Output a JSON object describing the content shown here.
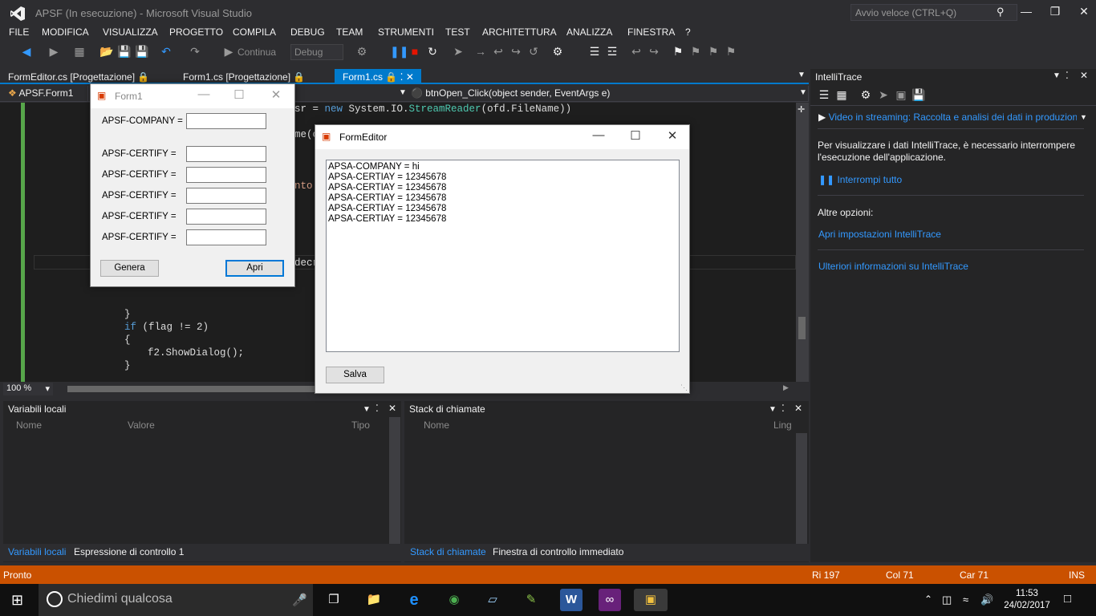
{
  "window": {
    "title": "APSF (In esecuzione) - Microsoft Visual Studio",
    "quick_launch": "Avvio veloce (CTRL+Q)"
  },
  "menu": [
    "FILE",
    "MODIFICA",
    "VISUALIZZA",
    "PROGETTO",
    "COMPILA",
    "DEBUG",
    "TEAM",
    "STRUMENTI",
    "TEST",
    "ARCHITETTURA",
    "ANALIZZA",
    "FINESTRA",
    "?"
  ],
  "toolbar": {
    "continue_label": "Continua",
    "config": "Debug"
  },
  "doc_tabs": [
    "FormEditor.cs [Progettazione]",
    "Form1.cs [Progettazione]",
    "Form1.cs"
  ],
  "nav": {
    "class": "APSF.Form1",
    "member": "btnOpen_Click(object sender, EventArgs e)"
  },
  "code": {
    "l1a": "sr = ",
    "l1b": "new ",
    "l1c": "System.IO.",
    "l1d": "StreamReader",
    "l1e": "(ofd.FileName))",
    "l2": "me(c",
    "l3": "nto",
    "l4": "decr",
    "l5": "}",
    "l6a": "if ",
    "l6b": "(flag != 2)",
    "l7": "{",
    "l8": "f2.ShowDialog();",
    "l9": "}"
  },
  "zoom": "100 %",
  "intellitrace": {
    "title": "IntelliTrace",
    "video_link": "Video in streaming: Raccolta e analisi dei dati in produzion",
    "info": "Per visualizzare i dati IntelliTrace, è necessario interrompere l'esecuzione dell'applicazione.",
    "break_all": "Interrompi tutto",
    "other": "Altre opzioni:",
    "settings": "Apri impostazioni IntelliTrace",
    "more": "Ulteriori informazioni su IntelliTrace"
  },
  "locals": {
    "title": "Variabili locali",
    "cols": [
      "Nome",
      "Valore",
      "Tipo"
    ],
    "tabs": [
      "Variabili locali",
      "Espressione di controllo 1"
    ]
  },
  "callstack": {
    "title": "Stack di chiamate",
    "cols": [
      "Nome",
      "Ling"
    ],
    "tabs": [
      "Stack di chiamate",
      "Finestra di controllo immediato"
    ]
  },
  "status": {
    "ready": "Pronto",
    "row": "Ri 197",
    "col": "Col 71",
    "car": "Car 71",
    "ins": "INS"
  },
  "form1": {
    "title": "Form1",
    "company_label": "APSF-COMPANY =",
    "certify_label": "APSF-CERTIFY =",
    "genera": "Genera",
    "apri": "Apri"
  },
  "formeditor": {
    "title": "FormEditor",
    "lines": [
      "APSA-COMPANY = hi",
      "APSA-CERTIAY = 12345678",
      "APSA-CERTIAY = 12345678",
      "APSA-CERTIAY = 12345678",
      "APSA-CERTIAY = 12345678",
      "APSA-CERTIAY = 12345678"
    ],
    "save": "Salva"
  },
  "taskbar": {
    "search": "Chiedimi qualcosa",
    "time": "11:53",
    "date": "24/02/2017"
  },
  "colors": {
    "accent": "#007acc",
    "status": "#ca5100",
    "bg": "#2d2d30",
    "link": "#3399ff"
  }
}
